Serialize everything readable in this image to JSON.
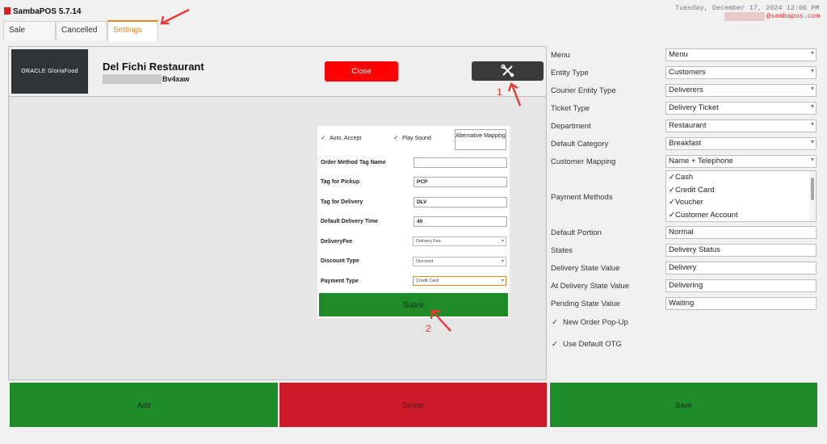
{
  "window": {
    "title": "SambaPOS 5.7.14",
    "datetime": "Tuesday, December 17, 2024 12:06 PM",
    "user_email": "@sambapos.com"
  },
  "tabs": [
    {
      "label": "Sale"
    },
    {
      "label": "Cancelled"
    },
    {
      "label": "Settings"
    }
  ],
  "header": {
    "logo_text": "ORACLE GloriaFood",
    "restaurant_name": "Del Fichi Restaurant",
    "restaurant_code": "Bv4xaw",
    "close_label": "Close",
    "tools_icon": "tools-icon"
  },
  "form": {
    "auto_accept_label": "Auto. Accept",
    "auto_accept_checked": true,
    "play_sound_label": "Play Sound",
    "play_sound_checked": true,
    "alternative_mapping_label": "Alternative Mapping",
    "order_method_tag_name_label": "Order Method Tag Name",
    "order_method_tag_name_value": "",
    "tag_for_pickup_label": "Tag for Pickup",
    "tag_for_pickup_value": "PCP",
    "tag_for_delivery_label": "Tag for Delivery",
    "tag_for_delivery_value": "DLV",
    "default_delivery_time_label": "Default Delivery Time",
    "default_delivery_time_value": "40",
    "delivery_fee_label": "DeliveryFee",
    "delivery_fee_value": "Delivery Fee",
    "discount_type_label": "Discount Type",
    "discount_type_value": "Discount",
    "payment_type_label": "Payment Type",
    "payment_type_value": "Credit Card",
    "save_label": "Save"
  },
  "annotations": {
    "marker_1": "1",
    "marker_2": "2",
    "arrow_color": "#e53935"
  },
  "bottom_buttons": {
    "add_label": "Add",
    "delete_label": "Delete",
    "save_label": "Save"
  },
  "settings": {
    "menu_label": "Menu",
    "menu_value": "Menu",
    "entity_type_label": "Entity Type",
    "entity_type_value": "Customers",
    "courier_entity_type_label": "Courier Entity Type",
    "courier_entity_type_value": "Deliverers",
    "ticket_type_label": "Ticket Type",
    "ticket_type_value": "Delivery Ticket",
    "department_label": "Department",
    "department_value": "Restaurant",
    "default_category_label": "Default Category",
    "default_category_value": "Breakfast",
    "customer_mapping_label": "Customer Mapping",
    "customer_mapping_value": "Name + Telephone",
    "payment_methods_label": "Payment Methods",
    "payment_methods": [
      {
        "label": "Cash",
        "checked": true
      },
      {
        "label": "Credit Card",
        "checked": true
      },
      {
        "label": "Voucher",
        "checked": true
      },
      {
        "label": "Customer Account",
        "checked": true
      }
    ],
    "default_portion_label": "Default Portion",
    "default_portion_value": "Normal",
    "states_label": "States",
    "states_value": "Delivery Status",
    "delivery_state_value_label": "Delivery State Value",
    "delivery_state_value": "Delivery",
    "at_delivery_state_value_label": "At Delivery State Value",
    "at_delivery_state_value": "Delivering",
    "pending_state_value_label": "Pending State Value",
    "pending_state_value": "Waiting",
    "new_order_popup_label": "New Order Pop-Up",
    "new_order_popup_checked": true,
    "use_default_otg_label": "Use Default OTG",
    "use_default_otg_checked": true
  },
  "colors": {
    "accent": "#e8871e",
    "close_red": "#fe0000",
    "save_green": "#1d8c28",
    "delete_red": "#cc1a28"
  }
}
